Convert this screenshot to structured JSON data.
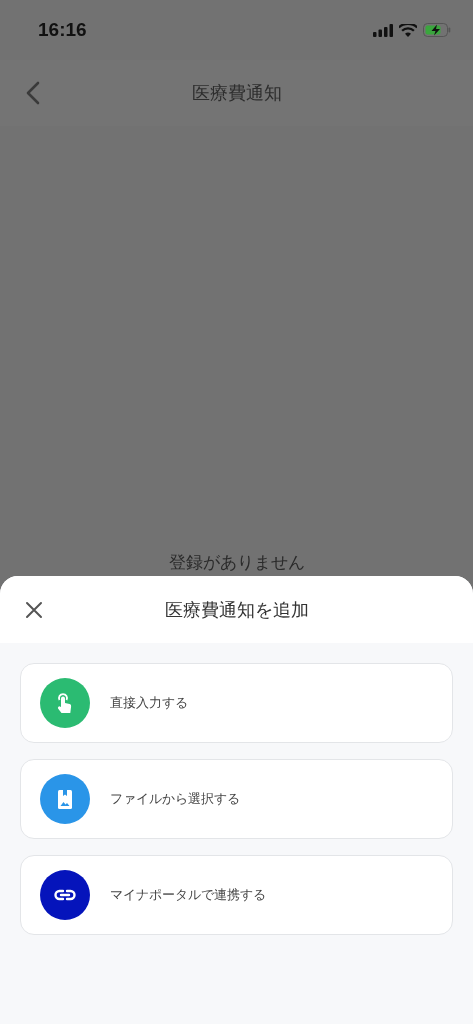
{
  "status_bar": {
    "time": "16:16"
  },
  "nav": {
    "title": "医療費通知"
  },
  "empty_message": "登録がありません",
  "sheet": {
    "title": "医療費通知を追加",
    "options": [
      {
        "kind": "touch",
        "label": "直接入力する",
        "color": "#2bbb72"
      },
      {
        "kind": "file",
        "label": "ファイルから選択する",
        "color": "#2a95e8"
      },
      {
        "kind": "link",
        "label": "マイナポータルで連携する",
        "color": "#0514bb"
      }
    ]
  }
}
